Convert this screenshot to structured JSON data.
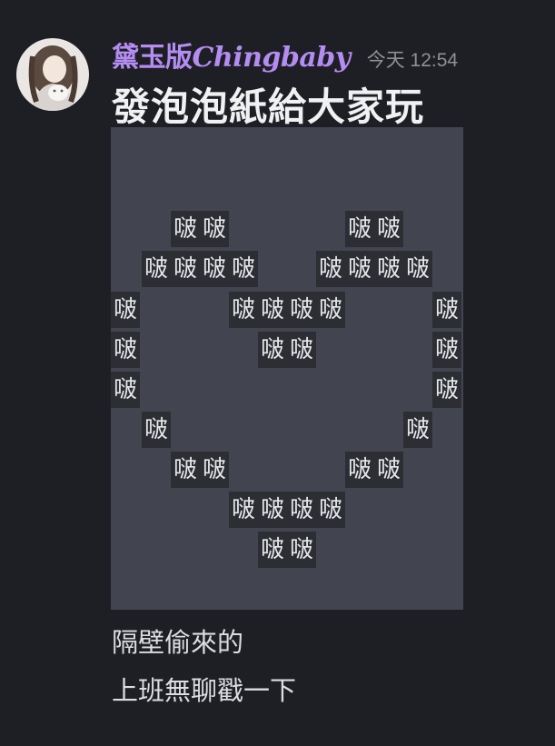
{
  "message": {
    "author": {
      "name_cjk": "黛玉版",
      "name_latin": "Chingbaby"
    },
    "timestamp": "今天 12:54",
    "title": "發泡泡紙給大家玩",
    "spoiler": {
      "bubble_char": "啵",
      "rows": [
        {
          "count": 2
        },
        {
          "count": 2
        },
        {
          "count": 4
        },
        {
          "count": 4
        },
        {
          "count": 1
        },
        {
          "count": 4
        },
        {
          "count": 1
        },
        {
          "count": 1
        },
        {
          "count": 2
        },
        {
          "count": 1
        },
        {
          "count": 1
        },
        {
          "count": 1
        },
        {
          "count": 1
        },
        {
          "count": 1
        },
        {
          "count": 1
        },
        {
          "count": 2
        },
        {
          "count": 2
        },
        {
          "count": 4
        },
        {
          "count": 2
        }
      ]
    },
    "lines": [
      "隔壁偷來的",
      "上班無聊戳一下"
    ]
  },
  "colors": {
    "background": "#1e1f24",
    "username": "#b48cf2",
    "timestamp": "#8e9097",
    "spoiler_background": "#424550",
    "bubble_background": "#2c2e34"
  },
  "icons": {
    "avatar": "user-avatar-girl-with-cat"
  }
}
